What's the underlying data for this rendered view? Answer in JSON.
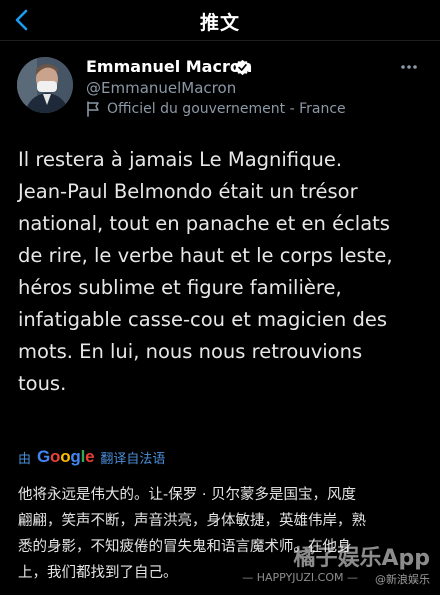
{
  "navbar": {
    "title": "推文",
    "back_icon": "chevron-left-icon"
  },
  "author": {
    "name": "Emmanuel Macron",
    "handle": "@EmmanuelMacron",
    "affiliation": "Officiel du gouvernement - France",
    "verified_color": "#ffffff"
  },
  "tweet": {
    "text": "Il restera à jamais Le Magnifique.\nJean-Paul Belmondo était un trésor\nnational, tout en panache et en éclats\nde rire, le verbe haut et le corps leste,\nhéros sublime et figure familière,\ninfatigable casse-cou et magicien des\nmots. En lui, nous nous retrouvions\ntous."
  },
  "translate": {
    "prefix": "由",
    "provider": "Google",
    "label": "翻译自法语"
  },
  "translation": {
    "text": "他将永远是伟大的。让-保罗 · 贝尔蒙多是国宝，风度\n翩翩，笑声不断，声音洪亮，身体敏捷，英雄伟岸，熟\n悉的身影，不知疲倦的冒失鬼和语言魔术师。在他身\n上，我们都找到了自己。"
  },
  "watermarks": {
    "big": "橘子娱乐App",
    "url": "— HAPPYJUZI.COM —",
    "weibo": "@新浪娱乐"
  },
  "colors": {
    "accent": "#1d9bf0",
    "link": "#4a8ed8",
    "muted": "#8b98a5"
  }
}
